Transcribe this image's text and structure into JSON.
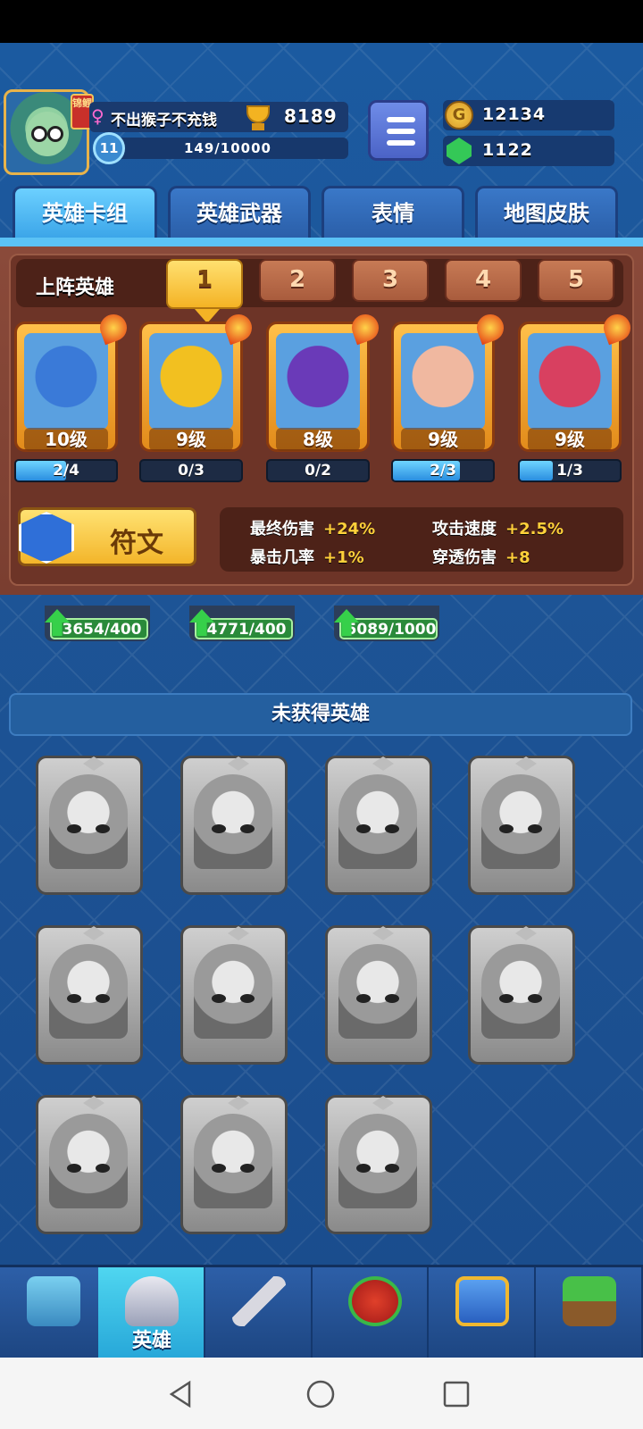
{
  "player": {
    "name": "不出猴子不充钱",
    "trophies": "8189",
    "level": "11",
    "xp": "149/10000",
    "avatar_tag": "锦鲤"
  },
  "currency": {
    "gold": "12134",
    "gems": "1122"
  },
  "tabs": [
    {
      "label": "英雄卡组"
    },
    {
      "label": "英雄武器"
    },
    {
      "label": "表情"
    },
    {
      "label": "地图皮肤"
    }
  ],
  "deck": {
    "label": "上阵英雄",
    "slots": [
      "1",
      "2",
      "3",
      "4",
      "5"
    ],
    "heroes": [
      {
        "level": "10级",
        "cards": "2/4",
        "progress": 0.5,
        "color": "#3a7ad8"
      },
      {
        "level": "9级",
        "cards": "0/3",
        "progress": 0.0,
        "color": "#f2c020"
      },
      {
        "level": "8级",
        "cards": "0/2",
        "progress": 0.0,
        "color": "#6a3ab8"
      },
      {
        "level": "9级",
        "cards": "2/3",
        "progress": 0.67,
        "color": "#f0b8a0"
      },
      {
        "level": "9级",
        "cards": "1/3",
        "progress": 0.33,
        "color": "#d84060"
      }
    ]
  },
  "rune": {
    "label": "符文"
  },
  "stats": {
    "final_damage": {
      "label": "最终伤害",
      "value": "+24%"
    },
    "attack_speed": {
      "label": "攻击速度",
      "value": "+2.5%"
    },
    "crit_rate": {
      "label": "暴击几率",
      "value": "+1%"
    },
    "pierce_damage": {
      "label": "穿透伤害",
      "value": "+8"
    }
  },
  "upgrades": [
    "3654/400",
    "4771/400",
    "5089/1000"
  ],
  "unowned": {
    "title": "未获得英雄",
    "count": 11
  },
  "nav": {
    "items": [
      {
        "name": "chest",
        "label": ""
      },
      {
        "name": "heroes",
        "label": "英雄"
      },
      {
        "name": "battle",
        "label": ""
      },
      {
        "name": "rank",
        "label": ""
      },
      {
        "name": "social",
        "label": ""
      },
      {
        "name": "garden",
        "label": ""
      }
    ]
  }
}
